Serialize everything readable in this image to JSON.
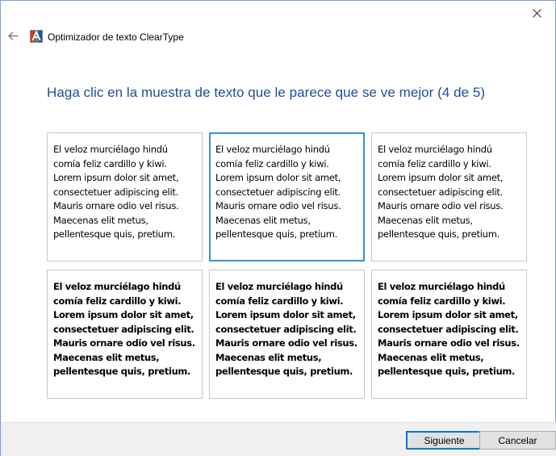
{
  "window": {
    "close_glyph": "close-icon"
  },
  "header": {
    "back_icon": "back-arrow-icon",
    "app_icon": "cleartype-icon",
    "title": "Optimizador de texto ClearType"
  },
  "instruction": "Haga clic en la muestra de texto que le parece que se ve mejor (4 de 5)",
  "samples": [
    {
      "text": "El veloz murciélago hindú\ncomía feliz cardillo y kiwi.\nLorem ipsum dolor sit amet,\nconsectetuer adipiscing elit.\nMauris ornare odio vel risus.\nMaecenas elit metus,\npellentesque quis, pretium.",
      "selected": false,
      "weight": "regular"
    },
    {
      "text": "El veloz murciélago hindú\ncomía feliz cardillo y kiwi.\nLorem ipsum dolor sit amet,\nconsectetuer adipiscing elit.\nMauris ornare odio vel risus.\nMaecenas elit metus,\npellentesque quis, pretium.",
      "selected": true,
      "weight": "regular"
    },
    {
      "text": "El veloz murciélago hindú\ncomía feliz cardillo y kiwi.\nLorem ipsum dolor sit amet,\nconsectetuer adipiscing elit.\nMauris ornare odio vel risus.\nMaecenas elit metus,\npellentesque quis, pretium.",
      "selected": false,
      "weight": "regular"
    },
    {
      "text": "El veloz murciélago hindú\ncomía feliz cardillo y kiwi.\nLorem ipsum dolor sit amet,\nconsectetuer adipiscing elit.\nMauris ornare odio vel risus.\nMaecenas elit metus,\npellentesque quis, pretium.",
      "selected": false,
      "weight": "bold"
    },
    {
      "text": "El veloz murciélago hindú\ncomía feliz cardillo y kiwi.\nLorem ipsum dolor sit amet,\nconsectetuer adipiscing elit.\nMauris ornare odio vel risus.\nMaecenas elit metus,\npellentesque quis, pretium.",
      "selected": false,
      "weight": "bold"
    },
    {
      "text": "El veloz murciélago hindú\ncomía feliz cardillo y kiwi.\nLorem ipsum dolor sit amet,\nconsectetuer adipiscing elit.\nMauris ornare odio vel risus.\nMaecenas elit metus,\npellentesque quis, pretium.",
      "selected": false,
      "weight": "bold"
    }
  ],
  "footer": {
    "next_label": "Siguiente",
    "cancel_label": "Cancelar"
  },
  "colors": {
    "instruction": "#1e4e9a",
    "selection_border": "#3f8fd2",
    "default_button_border": "#0078d7"
  }
}
